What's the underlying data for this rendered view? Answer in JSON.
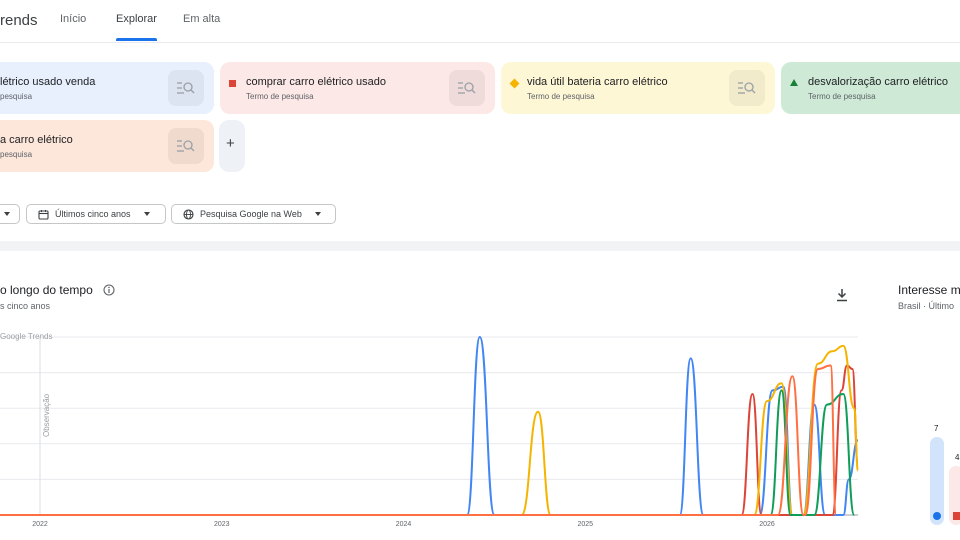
{
  "nav": {
    "brand": "rends",
    "tabs": [
      "Início",
      "Explorar",
      "Em alta"
    ]
  },
  "terms": [
    {
      "title": "létrico usado venda",
      "subtitle": " pesquisa",
      "color": "#4285f4"
    },
    {
      "title": "comprar carro elétrico usado",
      "subtitle": "Termo de pesquisa",
      "color": "#db4437"
    },
    {
      "title": "vida útil bateria carro elétrico",
      "subtitle": "Termo de pesquisa",
      "color": "#f4b400"
    },
    {
      "title": "desvalorização carro elétrico",
      "subtitle": "Termo de pesquisa",
      "color": "#0f9d58"
    },
    {
      "title": "a carro elétrico",
      "subtitle": " pesquisa",
      "color": "#ff7043"
    }
  ],
  "add_label": "+",
  "filters": {
    "time": "Últimos cinco anos",
    "property": "Pesquisa Google na Web"
  },
  "chart_section": {
    "title": "o longo do tempo",
    "subtitle": "s cinco anos",
    "watermark": "Google Trends",
    "note": "Observação"
  },
  "right_panel": {
    "title": "Interesse m",
    "subtitle": "Brasil · Último",
    "values": [
      "7",
      "4"
    ]
  },
  "chart_data": {
    "type": "line",
    "x_ticks": [
      "2022",
      "2023",
      "2024",
      "2025",
      "2026"
    ],
    "ylim": [
      0,
      100
    ],
    "grid": true,
    "legend": "none",
    "series": [
      {
        "color": "#4285f4",
        "points": [
          [
            2021.55,
            0
          ],
          [
            2024.35,
            0
          ],
          [
            2024.42,
            100
          ],
          [
            2024.5,
            0
          ],
          [
            2025.52,
            0
          ],
          [
            2025.58,
            88
          ],
          [
            2025.65,
            0
          ],
          [
            2025.96,
            0
          ],
          [
            2026.03,
            70
          ],
          [
            2026.09,
            72
          ],
          [
            2026.14,
            0
          ],
          [
            2026.2,
            0
          ],
          [
            2026.26,
            62
          ],
          [
            2026.32,
            0
          ],
          [
            2026.42,
            0
          ],
          [
            2026.45,
            20
          ],
          [
            2026.5,
            42
          ]
        ]
      },
      {
        "color": "#db4437",
        "points": [
          [
            2021.55,
            0
          ],
          [
            2025.86,
            0
          ],
          [
            2025.92,
            68
          ],
          [
            2025.97,
            0
          ],
          [
            2026.36,
            0
          ],
          [
            2026.41,
            70
          ],
          [
            2026.44,
            84
          ],
          [
            2026.47,
            82
          ],
          [
            2026.5,
            30
          ]
        ]
      },
      {
        "color": "#f4b400",
        "points": [
          [
            2021.55,
            0
          ],
          [
            2024.65,
            0
          ],
          [
            2024.74,
            58
          ],
          [
            2024.81,
            0
          ],
          [
            2025.93,
            0
          ],
          [
            2026.0,
            64
          ],
          [
            2026.08,
            74
          ],
          [
            2026.14,
            0
          ],
          [
            2026.2,
            0
          ],
          [
            2026.28,
            85
          ],
          [
            2026.36,
            92
          ],
          [
            2026.42,
            95
          ],
          [
            2026.48,
            60
          ],
          [
            2026.5,
            25
          ]
        ]
      },
      {
        "color": "#0f9d58",
        "points": [
          [
            2021.55,
            0
          ],
          [
            2026.02,
            0
          ],
          [
            2026.08,
            70
          ],
          [
            2026.13,
            0
          ],
          [
            2026.26,
            0
          ],
          [
            2026.33,
            62
          ],
          [
            2026.42,
            68
          ],
          [
            2026.48,
            0
          ]
        ]
      },
      {
        "color": "#ff7043",
        "points": [
          [
            2021.55,
            0
          ],
          [
            2026.06,
            0
          ],
          [
            2026.14,
            78
          ],
          [
            2026.2,
            0
          ],
          [
            2026.21,
            0
          ],
          [
            2026.28,
            82
          ],
          [
            2026.35,
            84
          ],
          [
            2026.38,
            0
          ]
        ]
      }
    ]
  }
}
